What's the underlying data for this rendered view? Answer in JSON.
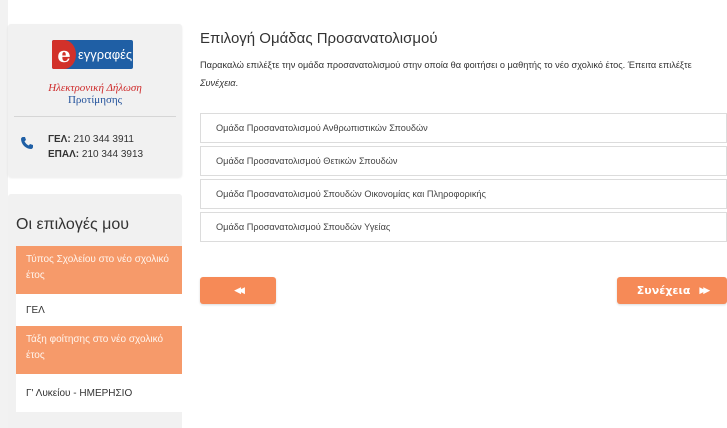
{
  "sidebar": {
    "logo": {
      "text": "εγγραφές",
      "line1": "Ηλεκτρονική Δήλωση",
      "line2": "Προτίμησης"
    },
    "contacts": [
      {
        "label": "ΓΕΛ:",
        "number": "210 344 3911"
      },
      {
        "label": "ΕΠΑΛ:",
        "number": "210 344 3913"
      }
    ],
    "choices_title": "Οι επιλογές μου",
    "choices": [
      {
        "heading": "Τύπος Σχολείου στο νέο σχολικό έτος",
        "value": "ΓΕΛ"
      },
      {
        "heading": "Τάξη φοίτησης στο νέο σχολικό έτος",
        "value": "Γ' Λυκείου - ΗΜΕΡΗΣΙΟ"
      }
    ]
  },
  "main": {
    "title": "Επιλογή Ομάδας Προσανατολισμού",
    "instructions_prefix": "Παρακαλώ επιλέξτε την ομάδα προσανατολισμού στην οποία θα φοιτήσει ο μαθητής το νέο σχολικό έτος. Έπειτα επιλέξτε ",
    "instructions_emphasis": "Συνέχεια",
    "instructions_suffix": ".",
    "options": [
      "Ομάδα Προσανατολισμού Ανθρωπιστικών Σπουδών",
      "Ομάδα Προσανατολισμού Θετικών Σπουδών",
      "Ομάδα Προσανατολισμού Σπουδών Οικονομίας και Πληροφορικής",
      "Ομάδα Προσανατολισμού Σπουδών Υγείας"
    ],
    "back_icon": "◀◀",
    "next_label": "Συνέχεια",
    "next_icon": "▶▶"
  },
  "colors": {
    "accent": "#f68a57",
    "logo_blue": "#1f5fa5",
    "logo_red": "#d2312a"
  }
}
